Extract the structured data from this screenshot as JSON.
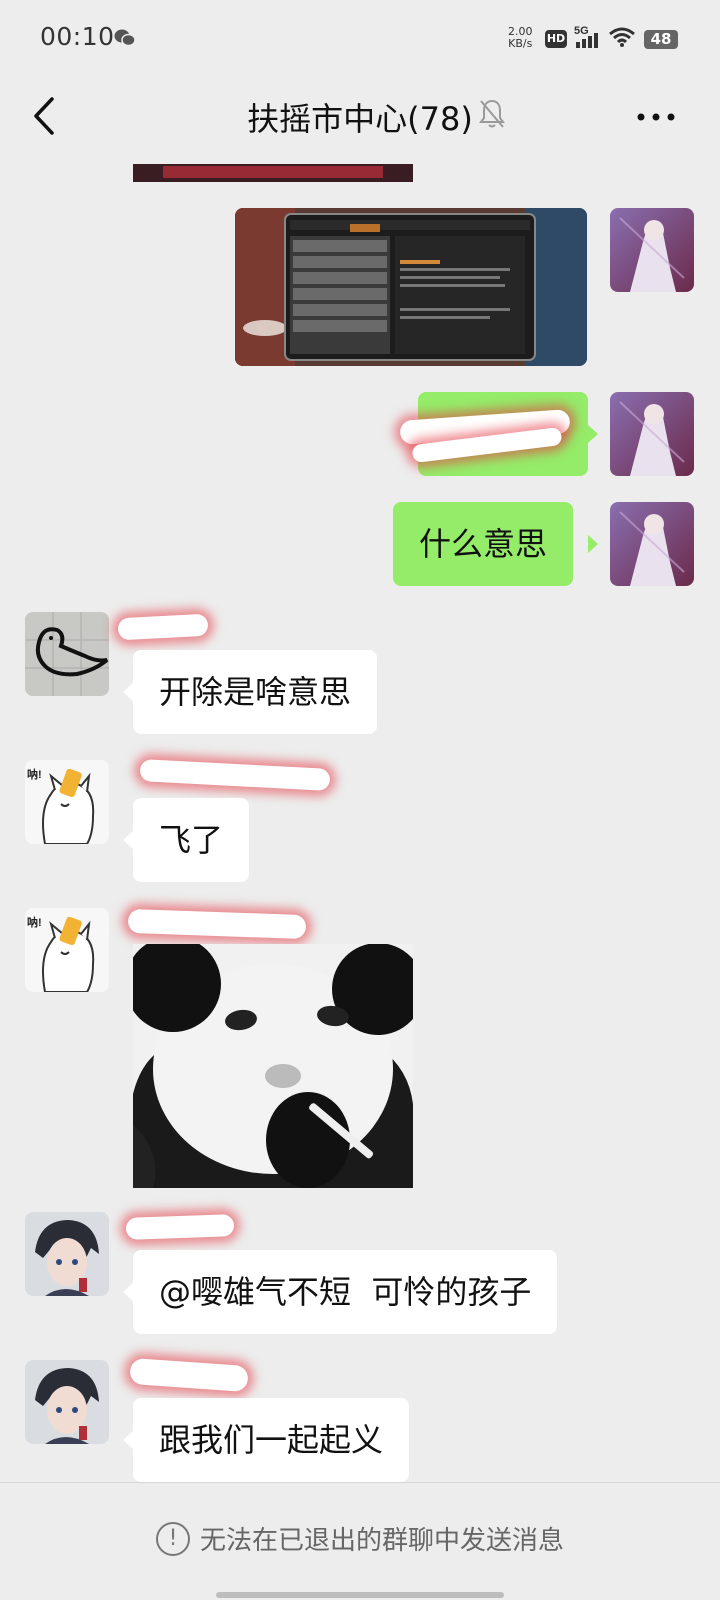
{
  "status": {
    "time": "00:10",
    "net_speed_value": "2.00",
    "net_speed_unit": "KB/s",
    "hd": "HD",
    "network": "5G",
    "battery": "48"
  },
  "header": {
    "title": "扶摇市中心(78)",
    "back_icon": "chevron-left-icon",
    "mute_icon": "bell-off-icon",
    "more_icon": "more-dots-icon"
  },
  "messages": [
    {
      "side": "out",
      "type": "image",
      "desc": "game-menu-screenshot"
    },
    {
      "side": "out",
      "type": "text",
      "text": "",
      "redacted": true
    },
    {
      "side": "out",
      "type": "text",
      "text": "什么意思"
    },
    {
      "side": "in",
      "type": "text",
      "text": "开除是啥意思"
    },
    {
      "side": "in",
      "type": "text",
      "text": "飞了"
    },
    {
      "side": "in",
      "type": "image",
      "desc": "panda-meme-sticker"
    },
    {
      "side": "in",
      "type": "text",
      "text": "@嘤雄气不短  可怜的孩子"
    },
    {
      "side": "in",
      "type": "text",
      "text": "跟我们一起起义"
    }
  ],
  "footer": {
    "notice": "无法在已退出的群聊中发送消息"
  },
  "colors": {
    "background": "#ededed",
    "bubble_out": "#95ec69",
    "bubble_in": "#ffffff",
    "scribble_glow": "#e63c46"
  }
}
